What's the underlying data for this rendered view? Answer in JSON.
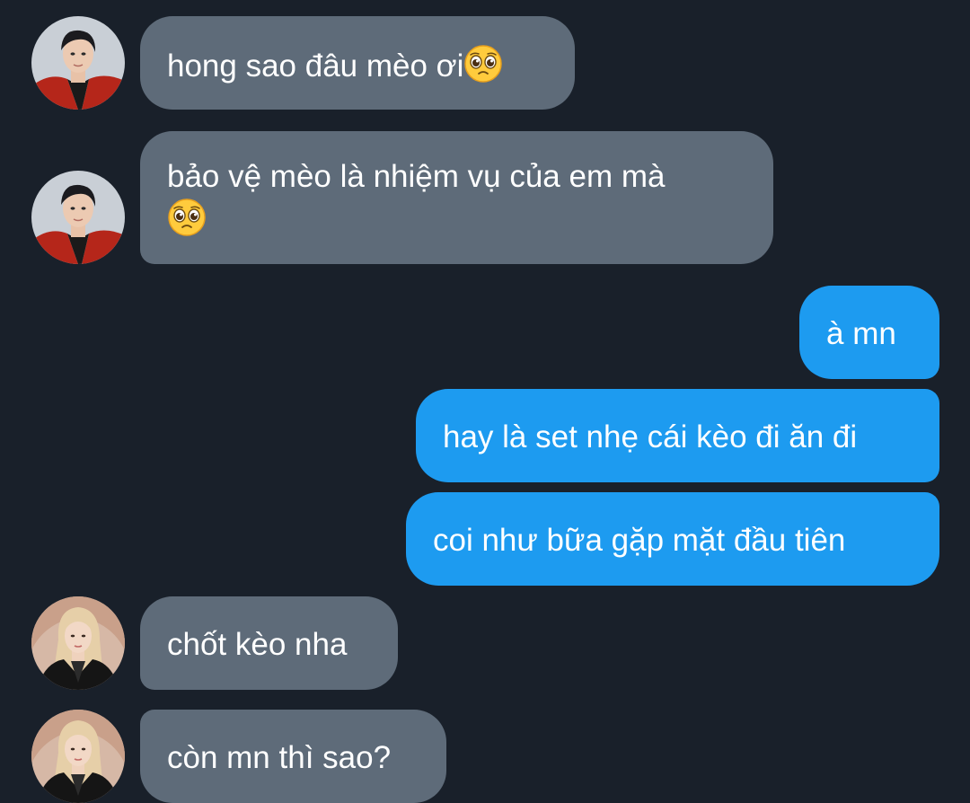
{
  "messages": [
    {
      "direction": "incoming",
      "sender_avatar": "avatar-boy-red-jacket",
      "text": "hong sao đâu mèo ơi",
      "emoji": "pleading-face-emoji"
    },
    {
      "direction": "incoming",
      "sender_avatar": "avatar-boy-red-jacket",
      "text": "bảo vệ mèo là nhiệm vụ của em mà",
      "emoji": "pleading-face-emoji"
    },
    {
      "direction": "outgoing",
      "text": "à mn"
    },
    {
      "direction": "outgoing",
      "text": "hay là set nhẹ cái kèo đi ăn đi"
    },
    {
      "direction": "outgoing",
      "text": "coi như bữa gặp mặt đầu tiên"
    },
    {
      "direction": "incoming",
      "sender_avatar": "avatar-blonde-black-blazer",
      "text": "chốt kèo nha"
    },
    {
      "direction": "incoming",
      "sender_avatar": "avatar-blonde-black-blazer",
      "text": "còn mn thì sao?"
    }
  ],
  "colors": {
    "background": "#19202a",
    "incoming_bubble": "#5e6b79",
    "outgoing_bubble": "#1d9bf0",
    "text": "#ffffff"
  }
}
